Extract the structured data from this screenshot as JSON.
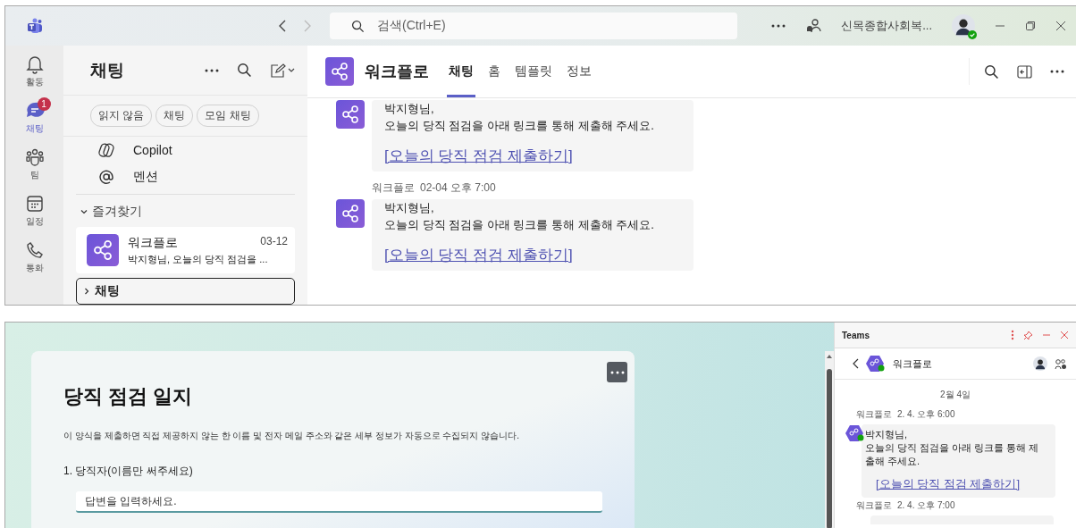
{
  "top": {
    "titlebar": {
      "search_placeholder": "검색(Ctrl+E)",
      "account": "신목종합사회복..."
    },
    "rail": [
      {
        "kind": "activity",
        "label": "활동",
        "selected": false
      },
      {
        "kind": "chat",
        "label": "채팅",
        "selected": true,
        "badge": "1"
      },
      {
        "kind": "teams",
        "label": "팀",
        "selected": false
      },
      {
        "kind": "calendar",
        "label": "일정",
        "selected": false
      },
      {
        "kind": "calls",
        "label": "통화",
        "selected": false
      }
    ],
    "chat_list": {
      "title": "채팅",
      "filters": [
        "읽지 않음",
        "채팅",
        "모임 채팅"
      ],
      "pinned": [
        {
          "kind": "copilot",
          "label": "Copilot"
        },
        {
          "kind": "mention",
          "label": "멘션"
        }
      ],
      "favorites": {
        "label": "즐겨찾기",
        "expanded": true,
        "items": [
          {
            "name": "워크플로",
            "date": "03-12",
            "preview": "박지형님, 오늘의 당직 점검을 ..."
          }
        ]
      },
      "chats_section": {
        "label": "채팅",
        "expanded": false
      }
    },
    "conversation": {
      "title": "워크플로",
      "tabs": [
        {
          "label": "채팅",
          "selected": true
        },
        {
          "label": "홈",
          "selected": false
        },
        {
          "label": "템플릿",
          "selected": false
        },
        {
          "label": "정보",
          "selected": false
        }
      ],
      "messages": [
        {
          "lines": [
            "박지형님,",
            "오늘의 당직 점검을 아래 링크를 통해 제출해 주세요."
          ],
          "link": "[오늘의 당직 점검 제출하기]"
        },
        {
          "sender": "워크플로",
          "time": "02-04 오후 7:00",
          "lines": [
            "박지형님,",
            "오늘의 당직 점검을 아래 링크를 통해 제출해 주세요."
          ],
          "link": "[오늘의 당직 점검 제출하기]"
        }
      ]
    }
  },
  "form": {
    "title": "당직 점검 일지",
    "notice": "이 양식을 제출하면 직접 제공하지 않는 한 이름 및 전자 메일 주소와 같은 세부 정보가 자동으로 수집되지 않습니다.",
    "questions": [
      {
        "label": "1. 당직자(이름만 써주세요)",
        "placeholder": "답변을 입력하세요."
      }
    ]
  },
  "side_panel": {
    "app_title": "Teams",
    "chat_title": "워크플로",
    "date_divider": "2월 4일",
    "messages": [
      {
        "sender": "워크플로",
        "time": "2. 4. 오후 6:00",
        "text": "박지형님,\n오늘의 당직 점검을 아래 링크를 통해 제출해 주세요.",
        "link": "[오늘의 당직 점검 제출하기]"
      },
      {
        "sender": "워크플로",
        "time": "2. 4. 오후 7:00"
      }
    ]
  }
}
